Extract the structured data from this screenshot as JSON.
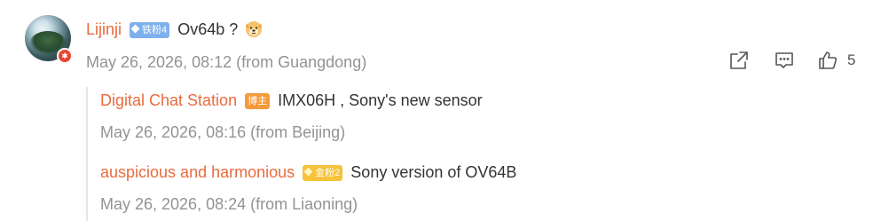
{
  "comment": {
    "author": "Lijinji",
    "badge": "铁粉4",
    "text": "Ov64b  ?",
    "emoji": "doge-emoji",
    "timestamp": "May 26, 2026, 08:12 (from Guangdong)",
    "like_count": "5"
  },
  "replies": [
    {
      "author": "Digital Chat Station",
      "badge": "博主",
      "text": "IMX06H   , Sony's new sensor",
      "timestamp": "May 26, 2026, 08:16 (from Beijing)"
    },
    {
      "author": "auspicious and harmonious",
      "badge": "金粉2",
      "text": "Sony  version of OV64B",
      "timestamp": "May 26, 2026, 08:24 (from Liaoning)"
    }
  ],
  "icons": {
    "share": "share-icon",
    "comment": "comment-icon",
    "like": "thumbs-up-icon"
  },
  "colors": {
    "username": "#e86b3d",
    "meta": "#939393",
    "badge_fan": "#7fb0ee",
    "badge_blogger": "#f59a3a",
    "badge_gold": "#f5c23a"
  }
}
